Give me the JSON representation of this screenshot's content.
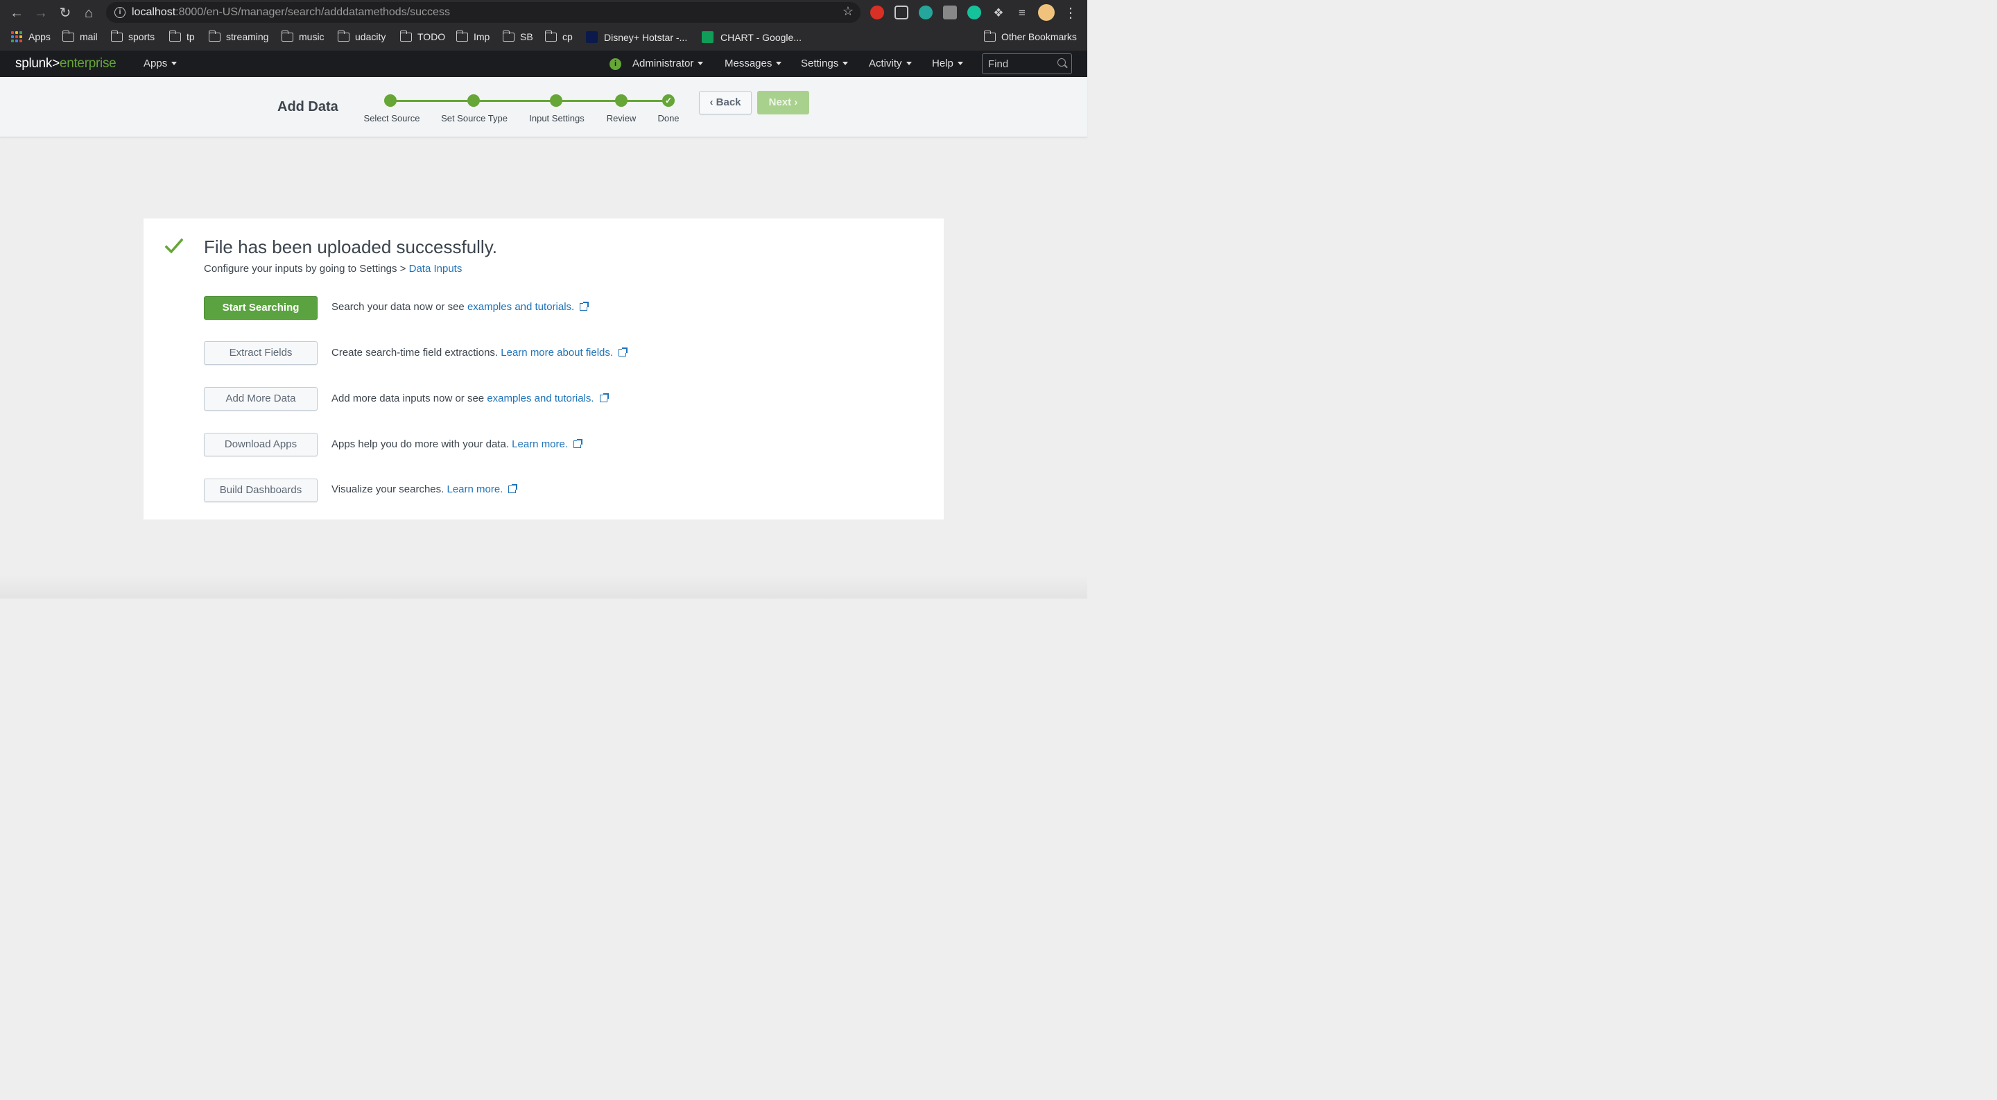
{
  "browser": {
    "url_host": "localhost",
    "url_path": ":8000/en-US/manager/search/adddatamethods/success",
    "bookmarks": [
      "Apps",
      "mail",
      "sports",
      "tp",
      "streaming",
      "music",
      "udacity",
      "TODO",
      "Imp",
      "SB",
      "cp",
      "Disney+ Hotstar -...",
      "CHART - Google...",
      "Other Bookmarks"
    ]
  },
  "splunk": {
    "logo_main": "splunk>",
    "logo_sub": "enterprise",
    "apps_menu": "Apps",
    "menus": [
      "Administrator",
      "Messages",
      "Settings",
      "Activity",
      "Help"
    ],
    "find_placeholder": "Find"
  },
  "wizard": {
    "title": "Add Data",
    "steps": [
      "Select Source",
      "Set Source Type",
      "Input Settings",
      "Review",
      "Done"
    ],
    "back_label": "Back",
    "next_label": "Next"
  },
  "result": {
    "headline": "File has been uploaded successfully.",
    "sub_text": "Configure your inputs by going to Settings >",
    "sub_link": "Data Inputs",
    "actions": [
      {
        "button": "Start Searching",
        "text": "Search your data now or see",
        "link": "examples and tutorials."
      },
      {
        "button": "Extract Fields",
        "text": "Create search-time field extractions.",
        "link": "Learn more about fields."
      },
      {
        "button": "Add More Data",
        "text": "Add more data inputs now or see",
        "link": "examples and tutorials."
      },
      {
        "button": "Download Apps",
        "text": "Apps help you do more with your data.",
        "link": "Learn more."
      },
      {
        "button": "Build Dashboards",
        "text": "Visualize your searches.",
        "link": "Learn more."
      }
    ]
  },
  "colors": {
    "accent_green": "#65a637",
    "link_blue": "#1e73b8",
    "header_bg": "#1a1c20"
  }
}
